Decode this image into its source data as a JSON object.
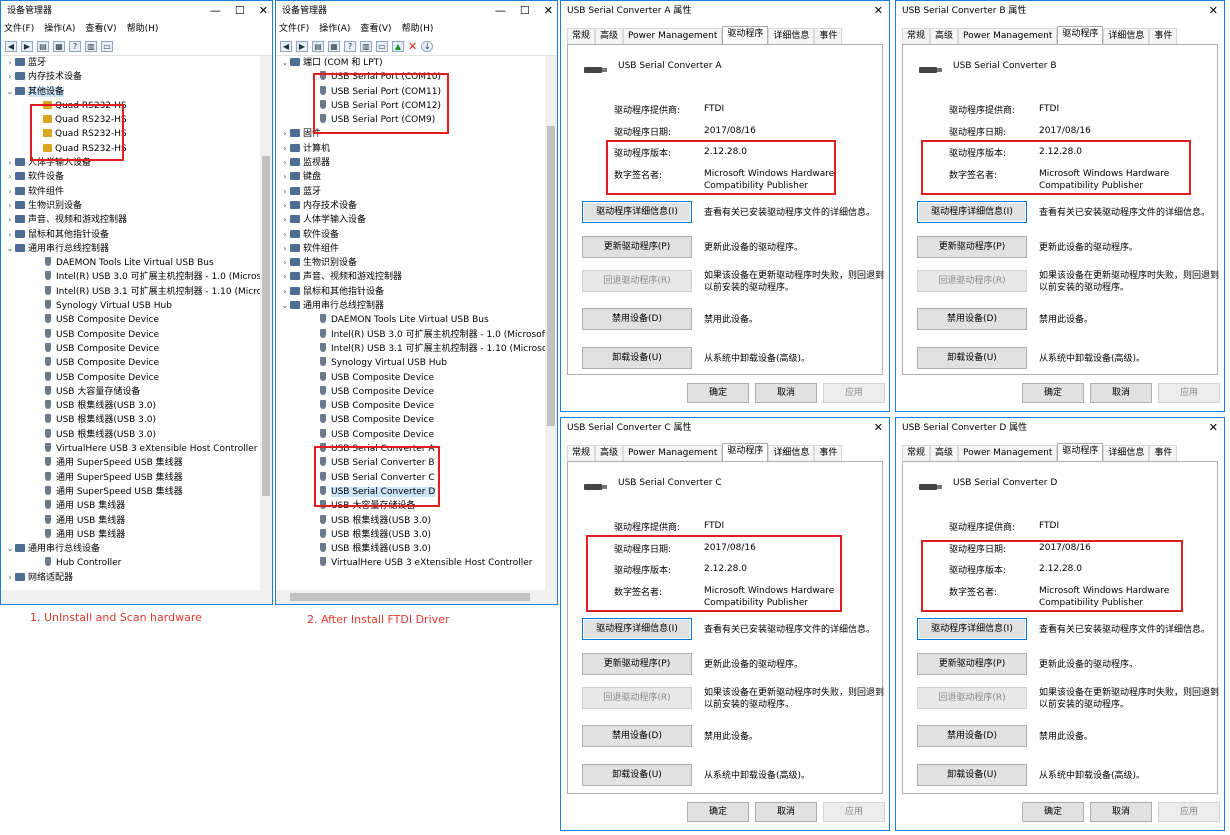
{
  "dm1": {
    "title": "设备管理器",
    "menu": [
      "文件(F)",
      "操作(A)",
      "查看(V)",
      "帮助(H)"
    ],
    "rows": [
      {
        "text": "蓝牙",
        "level": 0,
        "exp": "›",
        "icon": "cat"
      },
      {
        "text": "内存技术设备",
        "level": 0,
        "exp": "›",
        "icon": "cat"
      },
      {
        "text": "其他设备",
        "level": 0,
        "exp": "⌄",
        "icon": "cat",
        "selected": true
      },
      {
        "text": "Quad RS232-HS",
        "level": 1,
        "exp": "",
        "icon": "warn"
      },
      {
        "text": "Quad RS232-HS",
        "level": 1,
        "exp": "",
        "icon": "warn"
      },
      {
        "text": "Quad RS232-HS",
        "level": 1,
        "exp": "",
        "icon": "warn"
      },
      {
        "text": "Quad RS232-HS",
        "level": 1,
        "exp": "",
        "icon": "warn"
      },
      {
        "text": "人体学输入设备",
        "level": 0,
        "exp": "›",
        "icon": "cat"
      },
      {
        "text": "软件设备",
        "level": 0,
        "exp": "›",
        "icon": "cat"
      },
      {
        "text": "软件组件",
        "level": 0,
        "exp": "›",
        "icon": "cat"
      },
      {
        "text": "生物识别设备",
        "level": 0,
        "exp": "›",
        "icon": "cat"
      },
      {
        "text": "声音、视频和游戏控制器",
        "level": 0,
        "exp": "›",
        "icon": "cat"
      },
      {
        "text": "鼠标和其他指针设备",
        "level": 0,
        "exp": "›",
        "icon": "cat"
      },
      {
        "text": "通用串行总线控制器",
        "level": 0,
        "exp": "⌄",
        "icon": "cat"
      },
      {
        "text": "DAEMON Tools Lite Virtual USB Bus",
        "level": 1,
        "exp": "",
        "icon": "dev"
      },
      {
        "text": "Intel(R) USB 3.0 可扩展主机控制器 - 1.0 (Microsoft)",
        "level": 1,
        "exp": "",
        "icon": "dev"
      },
      {
        "text": "Intel(R) USB 3.1 可扩展主机控制器 - 1.10 (Microsoft)",
        "level": 1,
        "exp": "",
        "icon": "dev"
      },
      {
        "text": "Synology Virtual USB Hub",
        "level": 1,
        "exp": "",
        "icon": "dev"
      },
      {
        "text": "USB Composite Device",
        "level": 1,
        "exp": "",
        "icon": "dev"
      },
      {
        "text": "USB Composite Device",
        "level": 1,
        "exp": "",
        "icon": "dev"
      },
      {
        "text": "USB Composite Device",
        "level": 1,
        "exp": "",
        "icon": "dev"
      },
      {
        "text": "USB Composite Device",
        "level": 1,
        "exp": "",
        "icon": "dev"
      },
      {
        "text": "USB Composite Device",
        "level": 1,
        "exp": "",
        "icon": "dev"
      },
      {
        "text": "USB 大容量存储设备",
        "level": 1,
        "exp": "",
        "icon": "dev"
      },
      {
        "text": "USB 根集线器(USB 3.0)",
        "level": 1,
        "exp": "",
        "icon": "dev"
      },
      {
        "text": "USB 根集线器(USB 3.0)",
        "level": 1,
        "exp": "",
        "icon": "dev"
      },
      {
        "text": "USB 根集线器(USB 3.0)",
        "level": 1,
        "exp": "",
        "icon": "dev"
      },
      {
        "text": "VirtualHere USB 3 eXtensible Host Controller",
        "level": 1,
        "exp": "",
        "icon": "dev"
      },
      {
        "text": "通用 SuperSpeed USB 集线器",
        "level": 1,
        "exp": "",
        "icon": "dev"
      },
      {
        "text": "通用 SuperSpeed USB 集线器",
        "level": 1,
        "exp": "",
        "icon": "dev"
      },
      {
        "text": "通用 SuperSpeed USB 集线器",
        "level": 1,
        "exp": "",
        "icon": "dev"
      },
      {
        "text": "通用 USB 集线器",
        "level": 1,
        "exp": "",
        "icon": "dev"
      },
      {
        "text": "通用 USB 集线器",
        "level": 1,
        "exp": "",
        "icon": "dev"
      },
      {
        "text": "通用 USB 集线器",
        "level": 1,
        "exp": "",
        "icon": "dev"
      },
      {
        "text": "通用串行总线设备",
        "level": 0,
        "exp": "⌄",
        "icon": "cat"
      },
      {
        "text": "Hub Controller",
        "level": 1,
        "exp": "",
        "icon": "dev"
      },
      {
        "text": "网络适配器",
        "level": 0,
        "exp": "›",
        "icon": "cat"
      }
    ]
  },
  "dm2": {
    "title": "设备管理器",
    "menu": [
      "文件(F)",
      "操作(A)",
      "查看(V)",
      "帮助(H)"
    ],
    "rows": [
      {
        "text": "端口 (COM 和 LPT)",
        "level": 0,
        "exp": "⌄",
        "icon": "cat"
      },
      {
        "text": "USB Serial Port (COM10)",
        "level": 1,
        "exp": "",
        "icon": "dev"
      },
      {
        "text": "USB Serial Port (COM11)",
        "level": 1,
        "exp": "",
        "icon": "dev"
      },
      {
        "text": "USB Serial Port (COM12)",
        "level": 1,
        "exp": "",
        "icon": "dev"
      },
      {
        "text": "USB Serial Port (COM9)",
        "level": 1,
        "exp": "",
        "icon": "dev"
      },
      {
        "text": "固件",
        "level": 0,
        "exp": "›",
        "icon": "cat"
      },
      {
        "text": "计算机",
        "level": 0,
        "exp": "›",
        "icon": "cat"
      },
      {
        "text": "监视器",
        "level": 0,
        "exp": "›",
        "icon": "cat"
      },
      {
        "text": "键盘",
        "level": 0,
        "exp": "›",
        "icon": "cat"
      },
      {
        "text": "蓝牙",
        "level": 0,
        "exp": "›",
        "icon": "cat"
      },
      {
        "text": "内存技术设备",
        "level": 0,
        "exp": "›",
        "icon": "cat"
      },
      {
        "text": "人体学输入设备",
        "level": 0,
        "exp": "›",
        "icon": "cat"
      },
      {
        "text": "软件设备",
        "level": 0,
        "exp": "›",
        "icon": "cat"
      },
      {
        "text": "软件组件",
        "level": 0,
        "exp": "›",
        "icon": "cat"
      },
      {
        "text": "生物识别设备",
        "level": 0,
        "exp": "›",
        "icon": "cat"
      },
      {
        "text": "声音、视频和游戏控制器",
        "level": 0,
        "exp": "›",
        "icon": "cat"
      },
      {
        "text": "鼠标和其他指针设备",
        "level": 0,
        "exp": "›",
        "icon": "cat"
      },
      {
        "text": "通用串行总线控制器",
        "level": 0,
        "exp": "⌄",
        "icon": "cat"
      },
      {
        "text": "DAEMON Tools Lite Virtual USB Bus",
        "level": 1,
        "exp": "",
        "icon": "dev"
      },
      {
        "text": "Intel(R) USB 3.0 可扩展主机控制器 - 1.0 (Microsoft)",
        "level": 1,
        "exp": "",
        "icon": "dev"
      },
      {
        "text": "Intel(R) USB 3.1 可扩展主机控制器 - 1.10 (Microsoft)",
        "level": 1,
        "exp": "",
        "icon": "dev"
      },
      {
        "text": "Synology Virtual USB Hub",
        "level": 1,
        "exp": "",
        "icon": "dev"
      },
      {
        "text": "USB Composite Device",
        "level": 1,
        "exp": "",
        "icon": "dev"
      },
      {
        "text": "USB Composite Device",
        "level": 1,
        "exp": "",
        "icon": "dev"
      },
      {
        "text": "USB Composite Device",
        "level": 1,
        "exp": "",
        "icon": "dev"
      },
      {
        "text": "USB Composite Device",
        "level": 1,
        "exp": "",
        "icon": "dev"
      },
      {
        "text": "USB Composite Device",
        "level": 1,
        "exp": "",
        "icon": "dev"
      },
      {
        "text": "USB Serial Converter A",
        "level": 1,
        "exp": "",
        "icon": "dev"
      },
      {
        "text": "USB Serial Converter B",
        "level": 1,
        "exp": "",
        "icon": "dev"
      },
      {
        "text": "USB Serial Converter C",
        "level": 1,
        "exp": "",
        "icon": "dev"
      },
      {
        "text": "USB Serial Converter D",
        "level": 1,
        "exp": "",
        "icon": "dev",
        "selected": true
      },
      {
        "text": "USB 大容量存储设备",
        "level": 1,
        "exp": "",
        "icon": "dev"
      },
      {
        "text": "USB 根集线器(USB 3.0)",
        "level": 1,
        "exp": "",
        "icon": "dev"
      },
      {
        "text": "USB 根集线器(USB 3.0)",
        "level": 1,
        "exp": "",
        "icon": "dev"
      },
      {
        "text": "USB 根集线器(USB 3.0)",
        "level": 1,
        "exp": "",
        "icon": "dev"
      },
      {
        "text": "VirtualHere USB 3 eXtensible Host Controller",
        "level": 1,
        "exp": "",
        "icon": "dev"
      }
    ]
  },
  "captions": {
    "step1": "1. UnInstall and Scan hardware",
    "step2": "2. After Install FTDI Driver"
  },
  "dialog_common": {
    "tabs": [
      "常规",
      "高级",
      "Power Management",
      "驱动程序",
      "详细信息",
      "事件"
    ],
    "labels": {
      "provider": "驱动程序提供商:",
      "date": "驱动程序日期:",
      "version": "驱动程序版本:",
      "signer": "数字签名者:"
    },
    "values": {
      "provider": "FTDI",
      "date": "2017/08/16",
      "version": "2.12.28.0",
      "signer_line1": "Microsoft Windows Hardware",
      "signer_line2": "Compatibility Publisher"
    },
    "buttons": {
      "details": "驱动程序详细信息(I)",
      "update": "更新驱动程序(P)",
      "rollback": "回退驱动程序(R)",
      "disable": "禁用设备(D)",
      "uninstall": "卸载设备(U)"
    },
    "descriptions": {
      "details": "查看有关已安装驱动程序文件的详细信息。",
      "update": "更新此设备的驱动程序。",
      "rollback_line1": "如果该设备在更新驱动程序时失败，则回退到",
      "rollback_line2": "以前安装的驱动程序。",
      "disable": "禁用此设备。",
      "uninstall": "从系统中卸载设备(高级)。"
    },
    "footer": {
      "ok": "确定",
      "cancel": "取消",
      "apply": "应用"
    }
  },
  "dialogs": [
    {
      "title": "USB Serial Converter A 属性",
      "device": "USB Serial Converter A"
    },
    {
      "title": "USB Serial Converter B 属性",
      "device": "USB Serial Converter B"
    },
    {
      "title": "USB Serial Converter C 属性",
      "device": "USB Serial Converter C"
    },
    {
      "title": "USB Serial Converter D 属性",
      "device": "USB Serial Converter D"
    }
  ],
  "colors": {
    "window_border": "#1e7dd8",
    "highlight": "#e11d1d",
    "caption": "#e23b2f",
    "selection": "#cce4f7"
  }
}
